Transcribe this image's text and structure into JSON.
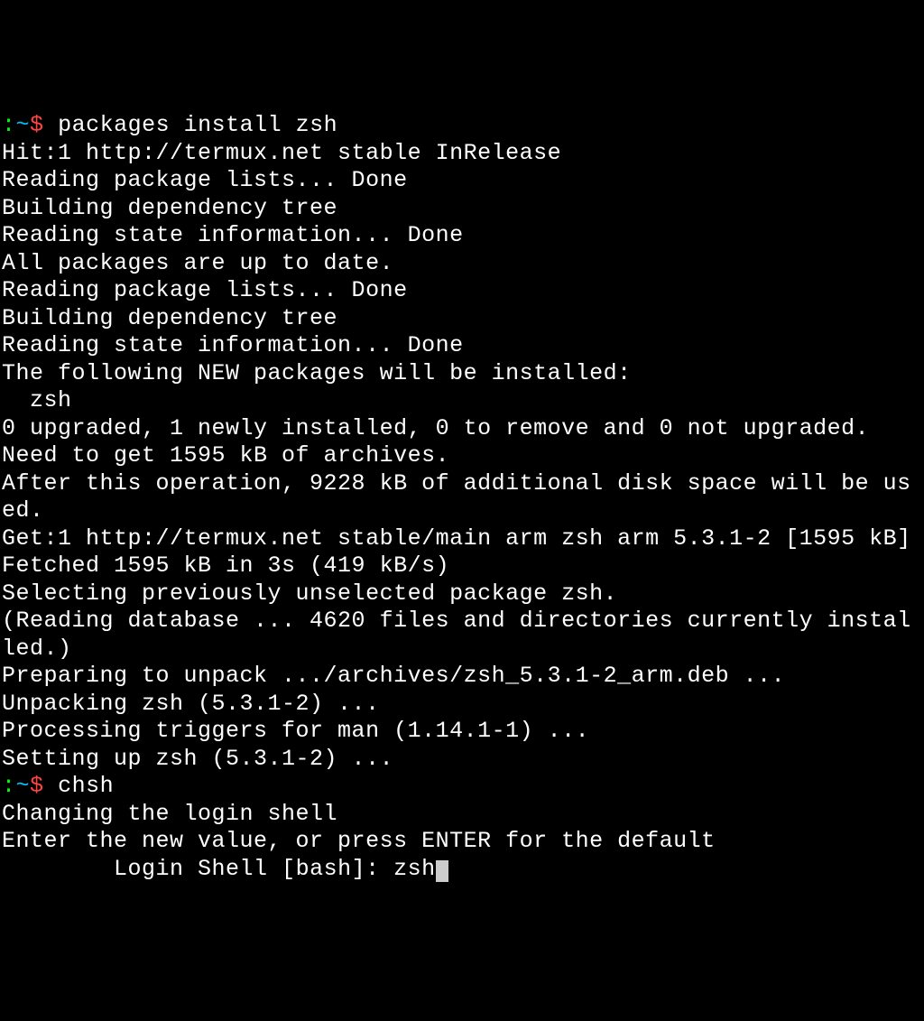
{
  "prompt1": {
    "colon": ":",
    "path": "~",
    "dollar": "$",
    "command": "packages install zsh"
  },
  "output1": [
    "Hit:1 http://termux.net stable InRelease",
    "Reading package lists... Done",
    "Building dependency tree",
    "Reading state information... Done",
    "All packages are up to date.",
    "Reading package lists... Done",
    "Building dependency tree",
    "Reading state information... Done",
    "The following NEW packages will be installed:",
    "  zsh",
    "0 upgraded, 1 newly installed, 0 to remove and 0 not upgraded.",
    "Need to get 1595 kB of archives.",
    "After this operation, 9228 kB of additional disk space will be used.",
    "Get:1 http://termux.net stable/main arm zsh arm 5.3.1-2 [1595 kB]",
    "Fetched 1595 kB in 3s (419 kB/s)",
    "Selecting previously unselected package zsh.",
    "(Reading database ... 4620 files and directories currently installed.)",
    "Preparing to unpack .../archives/zsh_5.3.1-2_arm.deb ...",
    "Unpacking zsh (5.3.1-2) ...",
    "Processing triggers for man (1.14.1-1) ...",
    "Setting up zsh (5.3.1-2) ..."
  ],
  "prompt2": {
    "colon": ":",
    "path": "~",
    "dollar": "$",
    "command": "chsh"
  },
  "output2": [
    "Changing the login shell",
    "Enter the new value, or press ENTER for the default"
  ],
  "login_shell_prompt": "        Login Shell [bash]: ",
  "login_shell_input": "zsh"
}
